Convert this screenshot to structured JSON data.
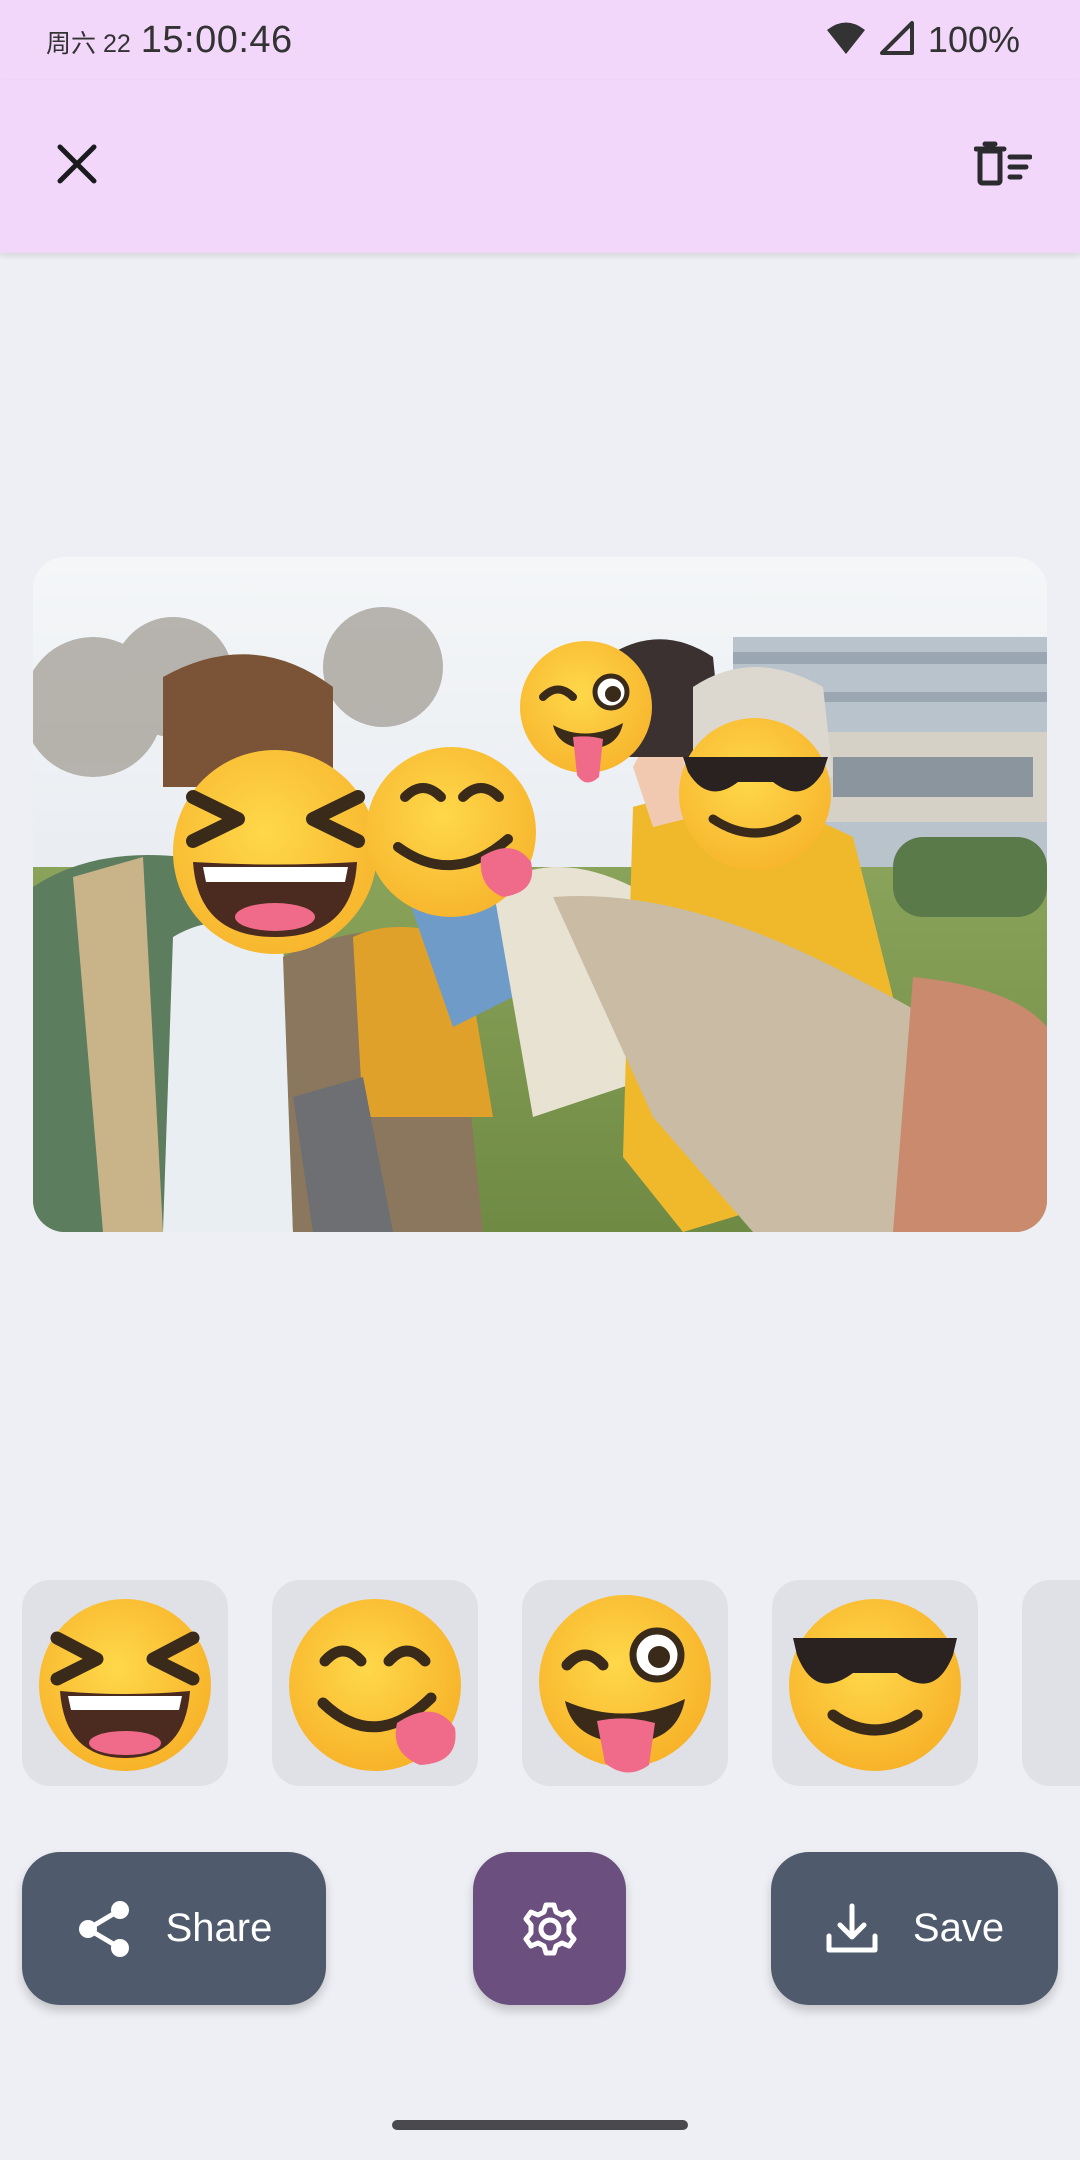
{
  "status_bar": {
    "date": "周六 22",
    "time": "15:00:46",
    "battery": "100%"
  },
  "app_bar": {
    "close_icon": "close-icon",
    "clear_icon": "delete-sweep-icon"
  },
  "photo": {
    "description_icon": "group-selfie-photo",
    "face_emojis": [
      "😆",
      "😋",
      "😜",
      "😎"
    ]
  },
  "emoji_picker": {
    "items": [
      "😆",
      "😋",
      "😜",
      "😎"
    ]
  },
  "actions": {
    "share_label": "Share",
    "save_label": "Save",
    "settings_icon": "gear-icon"
  },
  "colors": {
    "app_bar_bg": "#f2d7fa",
    "page_bg": "#eeeff4",
    "button_dark": "#4f5b6c",
    "button_accent": "#6a4f7f"
  }
}
